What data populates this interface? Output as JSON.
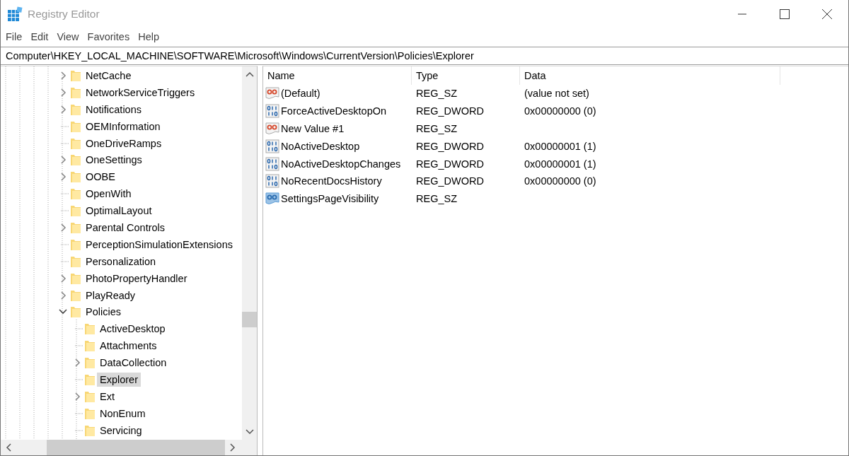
{
  "window": {
    "title": "Registry Editor"
  },
  "menu": [
    "File",
    "Edit",
    "View",
    "Favorites",
    "Help"
  ],
  "address": "Computer\\HKEY_LOCAL_MACHINE\\SOFTWARE\\Microsoft\\Windows\\CurrentVersion\\Policies\\Explorer",
  "tree": [
    {
      "label": "NetCache",
      "expanded": false,
      "selected": false
    },
    {
      "label": "NetworkServiceTriggers",
      "expanded": false,
      "selected": false
    },
    {
      "label": "Notifications",
      "expanded": false,
      "selected": false
    },
    {
      "label": "OEMInformation",
      "selected": false
    },
    {
      "label": "OneDriveRamps",
      "selected": false
    },
    {
      "label": "OneSettings",
      "expanded": false,
      "selected": false
    },
    {
      "label": "OOBE",
      "expanded": false,
      "selected": false
    },
    {
      "label": "OpenWith",
      "selected": false
    },
    {
      "label": "OptimalLayout",
      "selected": false
    },
    {
      "label": "Parental Controls",
      "expanded": false,
      "selected": false
    },
    {
      "label": "PerceptionSimulationExtensions",
      "selected": false
    },
    {
      "label": "Personalization",
      "selected": false
    },
    {
      "label": "PhotoPropertyHandler",
      "expanded": false,
      "selected": false
    },
    {
      "label": "PlayReady",
      "expanded": false,
      "selected": false
    },
    {
      "label": "Policies",
      "expanded": true,
      "selected": false,
      "children": [
        {
          "label": "ActiveDesktop",
          "selected": false
        },
        {
          "label": "Attachments",
          "selected": false
        },
        {
          "label": "DataCollection",
          "expanded": false,
          "selected": false
        },
        {
          "label": "Explorer",
          "selected": true
        },
        {
          "label": "Ext",
          "expanded": false,
          "selected": false
        },
        {
          "label": "NonEnum",
          "selected": false
        },
        {
          "label": "Servicing",
          "selected": false
        }
      ]
    }
  ],
  "values": {
    "columns": [
      "Name",
      "Type",
      "Data"
    ],
    "rows": [
      {
        "kind": "string",
        "name": "(Default)",
        "type": "REG_SZ",
        "data": "(value not set)",
        "selected": false
      },
      {
        "kind": "dword",
        "name": "ForceActiveDesktopOn",
        "type": "REG_DWORD",
        "data": "0x00000000 (0)",
        "selected": false
      },
      {
        "kind": "string",
        "name": "New Value #1",
        "type": "REG_SZ",
        "selected": false
      },
      {
        "kind": "dword",
        "name": "NoActiveDesktop",
        "type": "REG_DWORD",
        "data": "0x00000001 (1)",
        "selected": false
      },
      {
        "kind": "dword",
        "name": "NoActiveDesktopChanges",
        "type": "REG_DWORD",
        "data": "0x00000001 (1)",
        "selected": false
      },
      {
        "kind": "dword",
        "name": "NoRecentDocsHistory",
        "type": "REG_DWORD",
        "data": "0x00000000 (0)",
        "selected": false
      },
      {
        "kind": "string",
        "name": "SettingsPageVisibility",
        "type": "REG_SZ",
        "selected": true
      }
    ]
  }
}
